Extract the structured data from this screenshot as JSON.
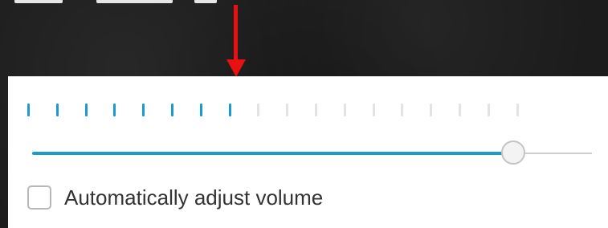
{
  "colors": {
    "accent": "#1a9bc9",
    "inactive_tick": "#e3e3e3",
    "arrow": "#e81010",
    "panel_background": "#ffffff",
    "page_background": "#1c1c1c"
  },
  "annotation": {
    "icon": "arrow-down-icon"
  },
  "volume_meter": {
    "total_ticks": 18,
    "active_ticks": 8
  },
  "volume_slider": {
    "value_fraction": 0.86
  },
  "auto_adjust": {
    "label": "Automatically adjust volume",
    "checked": false
  }
}
